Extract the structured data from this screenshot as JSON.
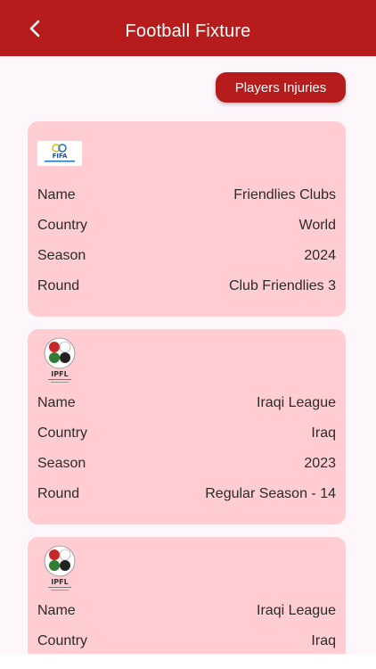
{
  "header": {
    "title": "Football Fixture",
    "background": "#b71c1c"
  },
  "actions": {
    "injuries_label": "Players Injuries"
  },
  "leagues": [
    {
      "logo": "fifa-logo",
      "rows": [
        {
          "label": "Name",
          "value": "Friendlies Clubs"
        },
        {
          "label": "Country",
          "value": "World"
        },
        {
          "label": "Season",
          "value": "2024"
        },
        {
          "label": "Round",
          "value": "Club Friendlies 3"
        }
      ]
    },
    {
      "logo": "ipfl-logo",
      "rows": [
        {
          "label": "Name",
          "value": "Iraqi League"
        },
        {
          "label": "Country",
          "value": "Iraq"
        },
        {
          "label": "Season",
          "value": "2023"
        },
        {
          "label": "Round",
          "value": "Regular Season - 14"
        }
      ]
    },
    {
      "logo": "ipfl-logo",
      "rows": [
        {
          "label": "Name",
          "value": "Iraqi League"
        },
        {
          "label": "Country",
          "value": "Iraq"
        }
      ]
    }
  ],
  "colors": {
    "accent": "#b71c1c",
    "card": "#ffcdd2",
    "page": "#fdf6fb"
  }
}
